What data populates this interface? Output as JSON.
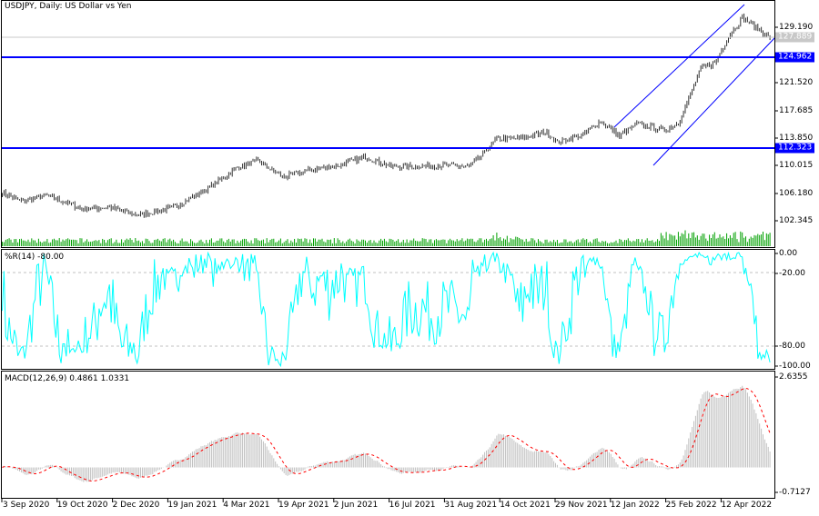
{
  "chart_title": "USDJPY, Daily:  US Dollar vs Yen",
  "price_axis": {
    "max": 129.19,
    "min": 102.345,
    "labels": [
      "129.190",
      "121.520",
      "117.685",
      "113.850",
      "110.015",
      "106.180",
      "102.345"
    ]
  },
  "current_price": "127.889",
  "levels": [
    {
      "value": "124.962",
      "color": "#0000ff"
    },
    {
      "value": "112.323",
      "color": "#0000ff"
    }
  ],
  "wpr": {
    "title": "%R(14) -80.00",
    "labels": [
      "0.00",
      "-20.00",
      "-80.00",
      "-100.00"
    ],
    "color": "#00ffff"
  },
  "macd": {
    "title": "MACD(12,26,9) 0.4861 1.0331",
    "max_label": "2.6355",
    "min_label": "-0.7127",
    "max": 2.6355,
    "min": -0.7127,
    "signal_color": "#ff0000",
    "hist_color": "#c0c0c0"
  },
  "dates": [
    "3 Sep 2020",
    "19 Oct 2020",
    "2 Dec 2020",
    "19 Jan 2021",
    "4 Mar 2021",
    "19 Apr 2021",
    "2 Jun 2021",
    "16 Jul 2021",
    "31 Aug 2021",
    "14 Oct 2021",
    "29 Nov 2021",
    "12 Jan 2022",
    "25 Feb 2022",
    "12 Apr 2022"
  ],
  "chart_data": {
    "type": "line",
    "title": "USDJPY, Daily",
    "bars_total": 445,
    "close_keypoints": [
      [
        0,
        106.25
      ],
      [
        12,
        105.0
      ],
      [
        25,
        105.9
      ],
      [
        46,
        104.0
      ],
      [
        62,
        104.2
      ],
      [
        78,
        103.1
      ],
      [
        99,
        104.2
      ],
      [
        112,
        105.9
      ],
      [
        125,
        107.8
      ],
      [
        136,
        109.7
      ],
      [
        148,
        110.7
      ],
      [
        162,
        108.4
      ],
      [
        178,
        109.4
      ],
      [
        194,
        110.0
      ],
      [
        210,
        111.2
      ],
      [
        225,
        109.9
      ],
      [
        241,
        109.9
      ],
      [
        257,
        110.0
      ],
      [
        270,
        109.9
      ],
      [
        278,
        111.5
      ],
      [
        286,
        113.8
      ],
      [
        299,
        113.7
      ],
      [
        315,
        114.7
      ],
      [
        321,
        113.2
      ],
      [
        336,
        114.3
      ],
      [
        346,
        116.2
      ],
      [
        357,
        114.1
      ],
      [
        367,
        115.8
      ],
      [
        383,
        114.9
      ],
      [
        391,
        115.9
      ],
      [
        399,
        120.4
      ],
      [
        404,
        123.5
      ],
      [
        412,
        124.2
      ],
      [
        420,
        127.9
      ],
      [
        428,
        130.5
      ],
      [
        436,
        129.2
      ],
      [
        444,
        127.7
      ]
    ],
    "volume_color": "#00a000"
  }
}
